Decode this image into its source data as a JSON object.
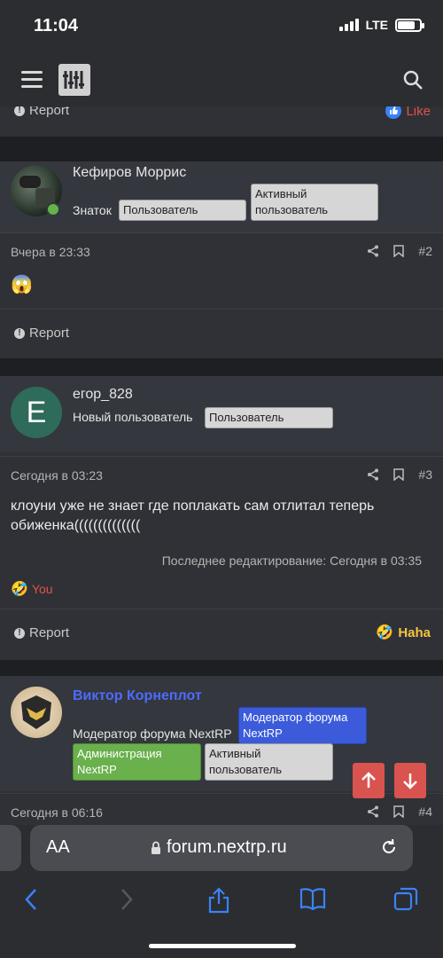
{
  "status_bar": {
    "time": "11:04",
    "network": "LTE"
  },
  "posts": {
    "top_partial": {
      "report_label": "Report",
      "like_label": "Like"
    },
    "post2": {
      "username": "Кефиров Моррис",
      "title": "Знаток",
      "badges": [
        "Пользователь",
        "Активный пользователь"
      ],
      "date": "Вчера в 23:33",
      "number": "#2",
      "content": "😱",
      "report_label": "Report"
    },
    "post3": {
      "avatar_letter": "E",
      "username": "егор_828",
      "title": "Новый пользователь",
      "badges": [
        "Пользователь"
      ],
      "date": "Сегодня в 03:23",
      "number": "#3",
      "content": "клоуни уже не знает где поплакать сам отлитал теперь обиженка((((((((((((((",
      "edited": "Последнее редактирование: Сегодня в 03:35",
      "reaction_you": "You",
      "report_label": "Report",
      "haha_label": "Haha"
    },
    "post4": {
      "username": "Виктор Корнеплот",
      "title": "Модератор форума NextRP",
      "badges": [
        "Модератор форума NextRP",
        "Администрация NextRP",
        "Активный пользователь"
      ],
      "date": "Сегодня в 06:16",
      "number": "#4"
    }
  },
  "browser": {
    "aa_label": "AA",
    "url": "forum.nextrp.ru"
  },
  "colors": {
    "like_blue": "#3b82f6",
    "report_red": "#e0514c",
    "moderator_blue": "#3b5bdb",
    "admin_green": "#6ab04c",
    "haha_yellow": "#f5c542"
  }
}
